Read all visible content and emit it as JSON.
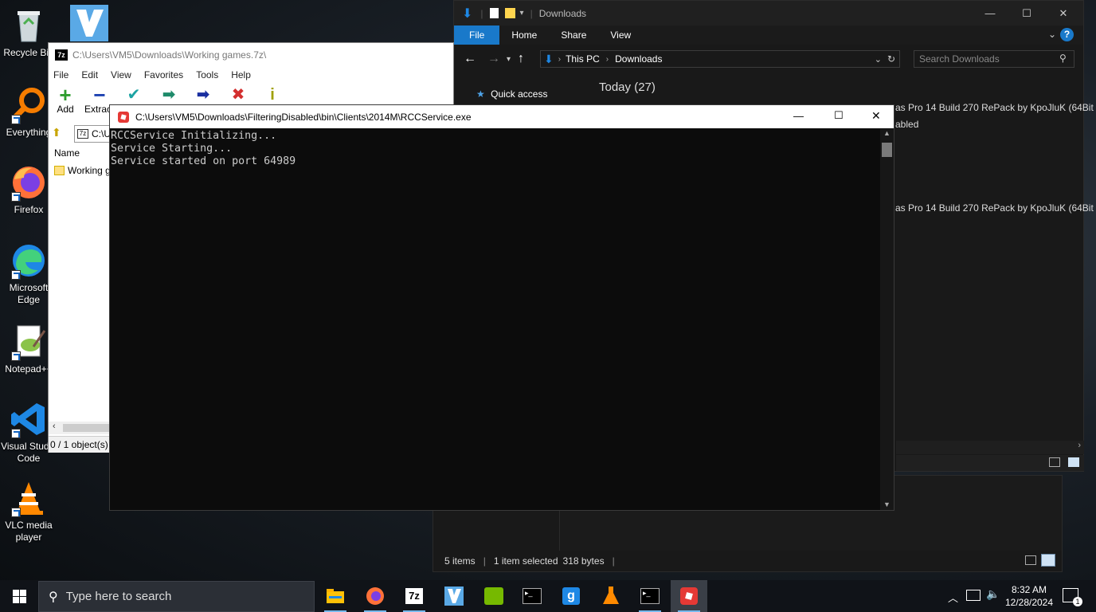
{
  "desktop": {
    "icons": [
      {
        "label": "Recycle Bin",
        "icon": "recycle-bin-icon"
      },
      {
        "label": "Everything",
        "icon": "everything-icon"
      },
      {
        "label": "Firefox",
        "icon": "firefox-icon"
      },
      {
        "label": "Microsoft Edge",
        "icon": "edge-icon"
      },
      {
        "label": "Notepad++",
        "icon": "notepad-plus-plus-icon"
      },
      {
        "label": "Visual Studio Code",
        "icon": "vscode-icon"
      },
      {
        "label": "VLC media player",
        "icon": "vlc-icon"
      }
    ]
  },
  "explorer": {
    "title": "Downloads",
    "tabs": [
      "File",
      "Home",
      "Share",
      "View"
    ],
    "breadcrumb": [
      "This PC",
      "Downloads"
    ],
    "search_placeholder": "Search Downloads",
    "nav": {
      "quick_access": "Quick access"
    },
    "group_header": "Today (27)",
    "file_fragments": [
      "as Pro 14 Build 270 RePack by KpoJluK (64Bit",
      "abled",
      "as Pro 14 Build 270 RePack by KpoJluK (64Bit"
    ],
    "status": {
      "items": "5 items",
      "selected": "1 item selected",
      "size": "318 bytes"
    }
  },
  "sevenzip": {
    "title": "C:\\Users\\VM5\\Downloads\\Working games.7z\\",
    "menu": [
      "File",
      "Edit",
      "View",
      "Favorites",
      "Tools",
      "Help"
    ],
    "toolbar": [
      "Add",
      "Extract",
      "Test",
      "Copy",
      "Move",
      "Delete",
      "Info"
    ],
    "path_value": "C:\\U",
    "column_name": "Name",
    "row_name": "Working g",
    "status": "0 / 1 object(s)"
  },
  "console": {
    "title": "C:\\Users\\VM5\\Downloads\\FilteringDisabled\\bin\\Clients\\2014M\\RCCService.exe",
    "lines": [
      "RCCService Initializing...",
      "Service Starting...",
      "Service started on port 64989"
    ]
  },
  "taskbar": {
    "search_placeholder": "Type here to search",
    "apps": [
      "file-explorer-icon",
      "firefox-icon",
      "7zip-icon",
      "visual-studio-icon",
      "nvidia-icon",
      "terminal-icon",
      "gmod-icon",
      "flask-icon",
      "console-icon",
      "roblox-icon"
    ],
    "time": "8:32 AM",
    "date": "12/28/2024"
  },
  "colors": {
    "explorer_accent": "#1979ca",
    "console_bg": "#0c0c0c",
    "taskbar_bg": "#101318"
  }
}
